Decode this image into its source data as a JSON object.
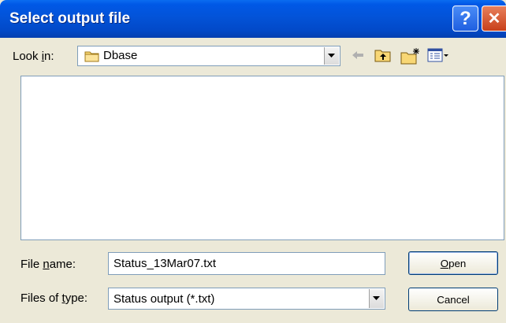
{
  "window": {
    "title": "Select output file",
    "help_glyph": "?",
    "close_glyph": "✕"
  },
  "lookin": {
    "label_pre": "Look ",
    "label_mnemonic": "i",
    "label_post": "n:",
    "value": "Dbase",
    "icons": [
      "folder-icon",
      "back-arrow-icon",
      "up-one-level-icon",
      "new-folder-icon",
      "view-menu-icon"
    ]
  },
  "filename": {
    "label_pre": "File ",
    "label_mnemonic": "n",
    "label_post": "ame:",
    "value": "Status_13Mar07.txt"
  },
  "filetype": {
    "label": "Files of type:",
    "label_pre": "Files of ",
    "label_mnemonic": "t",
    "label_post": "ype:",
    "value": "Status output (*.txt)"
  },
  "buttons": {
    "open_mnemonic": "O",
    "open_rest": "pen",
    "cancel": "Cancel"
  },
  "colors": {
    "titlebar": "#0353d8",
    "dialog_bg": "#ece9d8",
    "border": "#7f9db9"
  }
}
